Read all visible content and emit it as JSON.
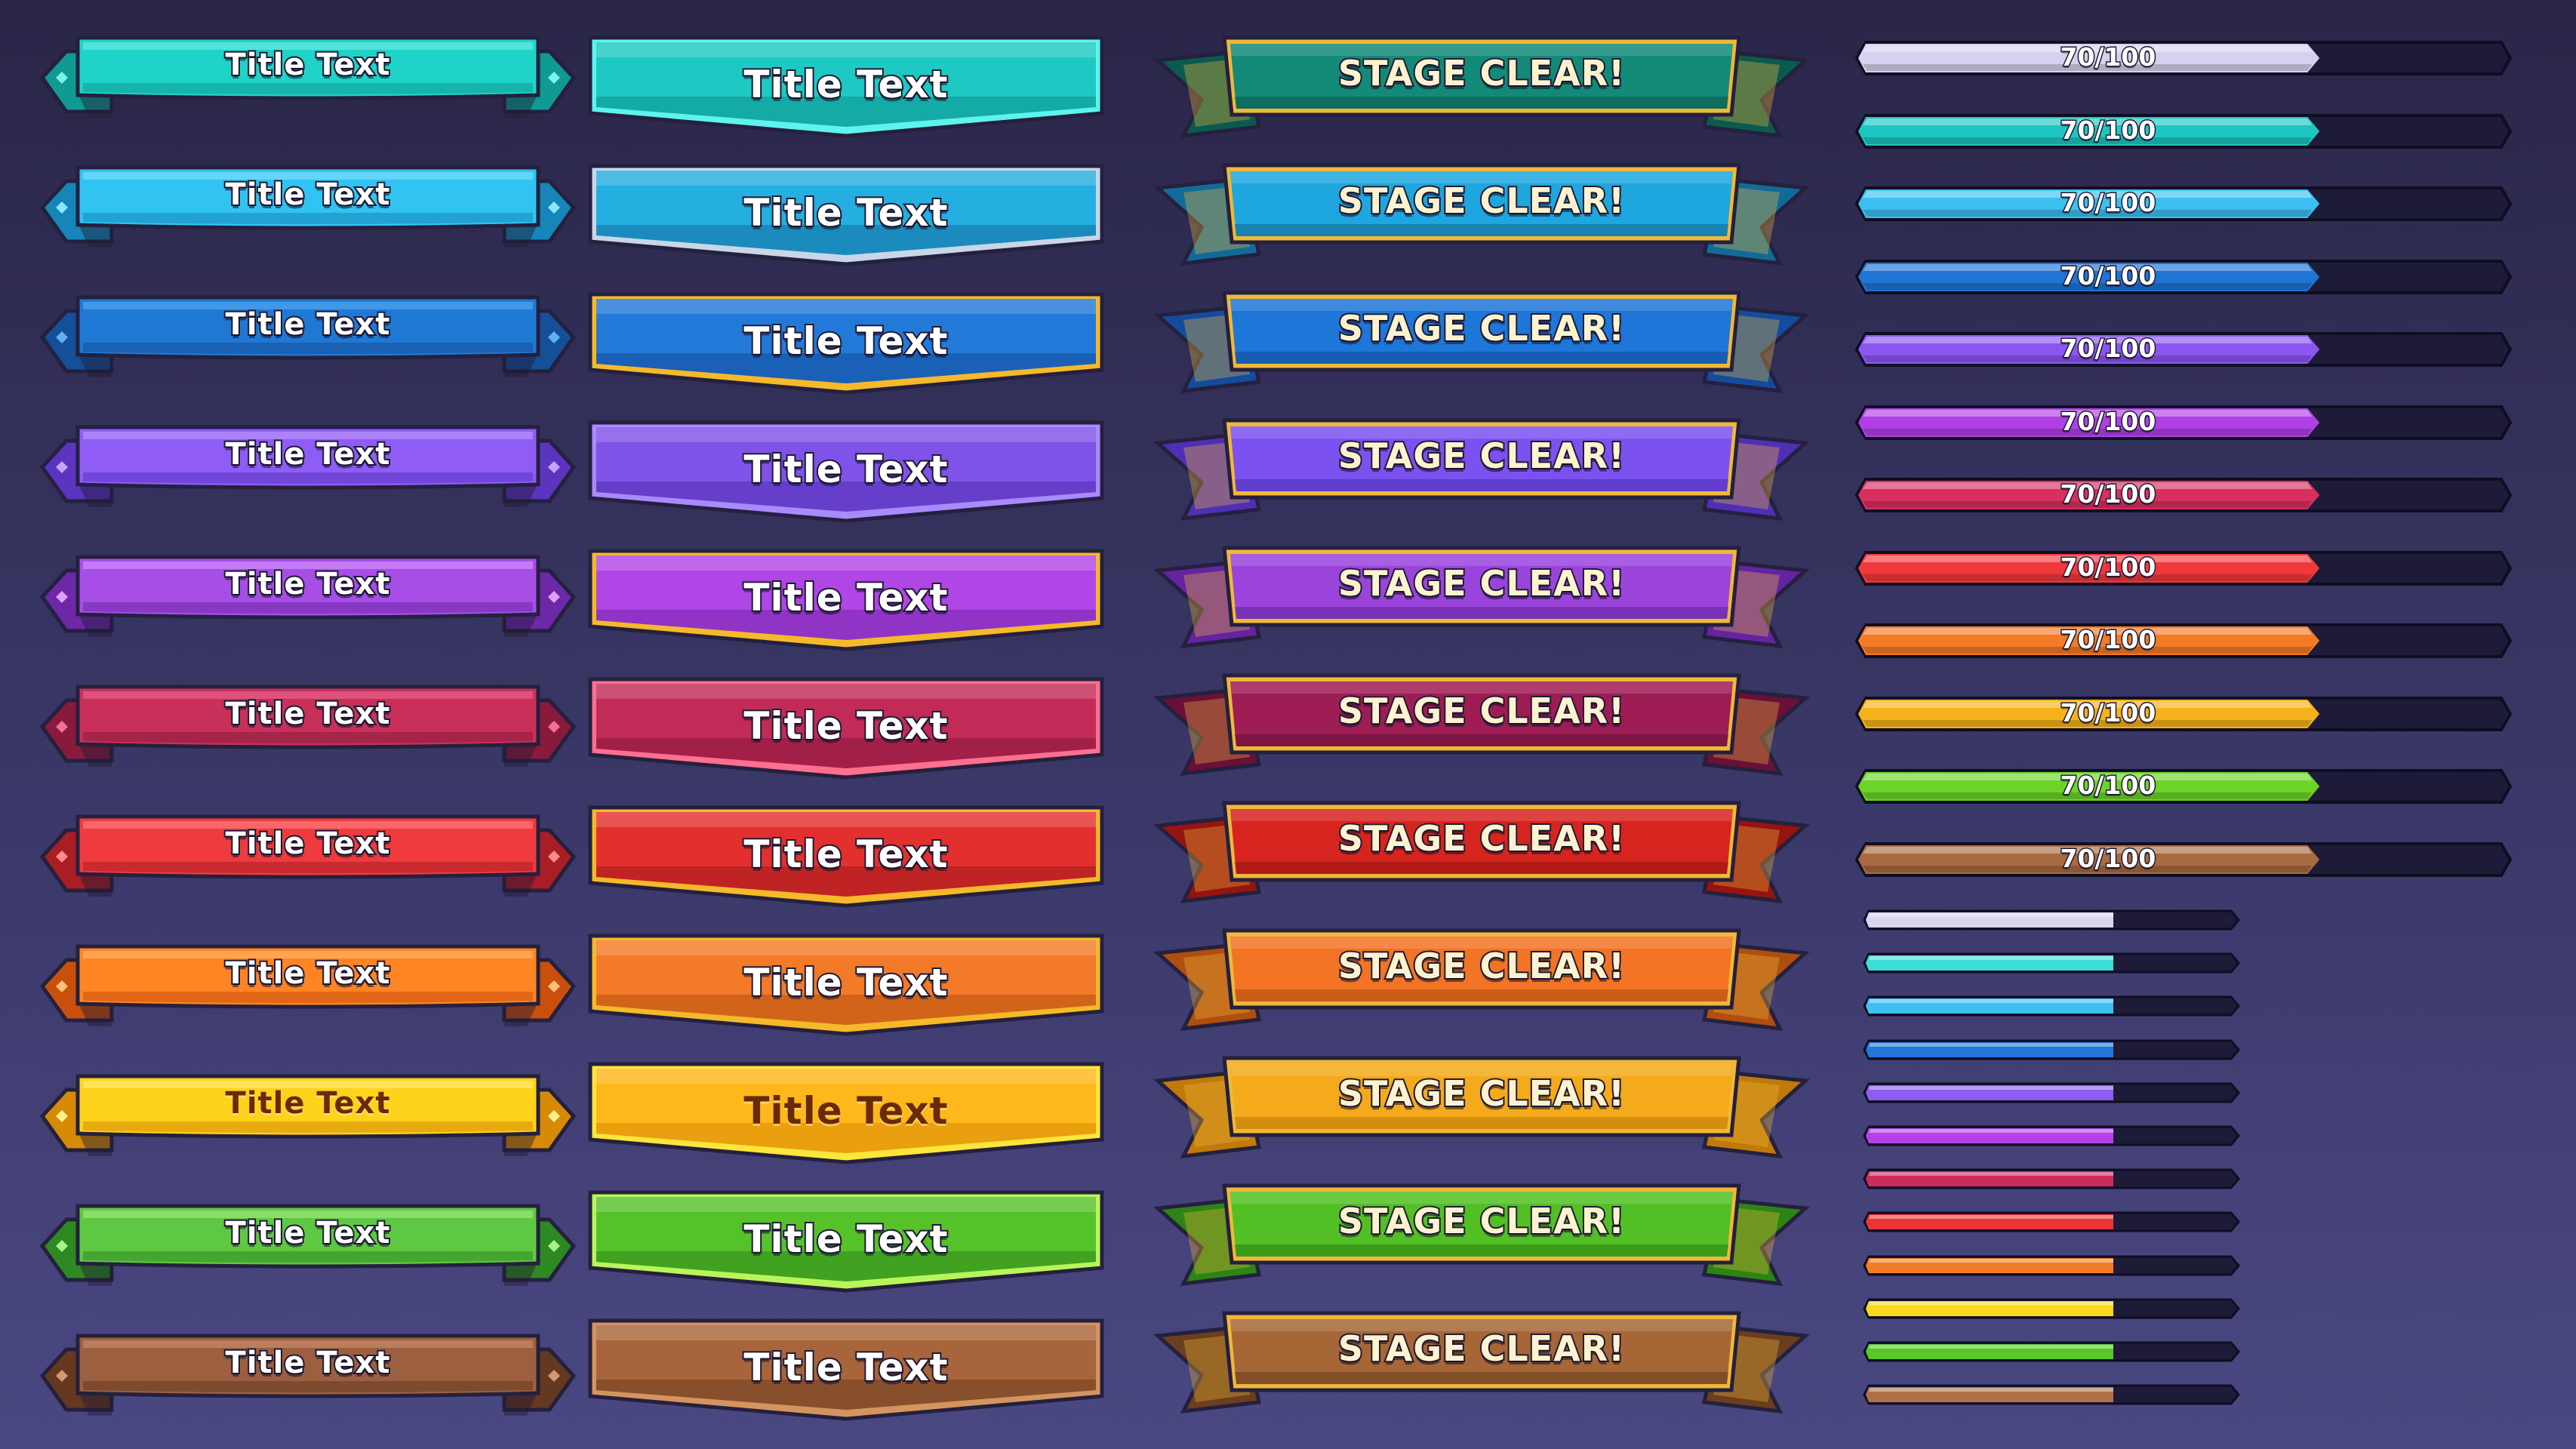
{
  "column_a": {
    "label": "Title Text",
    "colors": [
      {
        "main": "#1fd3c8",
        "dark": "#0f9a93",
        "light": "#7af3ea",
        "textDark": false
      },
      {
        "main": "#31c4f2",
        "dark": "#1686b8",
        "light": "#8ce6ff",
        "textDark": false
      },
      {
        "main": "#1f79d4",
        "dark": "#144f98",
        "light": "#5fb0f5",
        "textDark": false
      },
      {
        "main": "#8f5cf5",
        "dark": "#5b34c0",
        "light": "#c4a4ff",
        "textDark": false
      },
      {
        "main": "#a64ee6",
        "dark": "#6d28a8",
        "light": "#dca0ff",
        "textDark": false
      },
      {
        "main": "#c8305a",
        "dark": "#8a1a3c",
        "light": "#f0709a",
        "textDark": false
      },
      {
        "main": "#ef3a3e",
        "dark": "#a81e24",
        "light": "#ff8a8a",
        "textDark": false
      },
      {
        "main": "#ff8424",
        "dark": "#c9500c",
        "light": "#ffc07a",
        "textDark": false
      },
      {
        "main": "#ffd21c",
        "dark": "#d68a06",
        "light": "#fff08a",
        "textDark": true
      },
      {
        "main": "#5fc842",
        "dark": "#2d8a22",
        "light": "#aaf08a",
        "textDark": false
      },
      {
        "main": "#9c6040",
        "dark": "#653820",
        "light": "#d39874",
        "textDark": false
      }
    ]
  },
  "column_b": {
    "label": "Title Text",
    "colors": [
      {
        "main": "#1ec9c4",
        "dark": "#0d8f8c",
        "border": "#5ff3ee",
        "textDark": false
      },
      {
        "main": "#25aee0",
        "dark": "#146fa0",
        "border": "#c9d6e8",
        "textDark": false
      },
      {
        "main": "#2279d8",
        "dark": "#154d9c",
        "border": "#f5b92a",
        "textDark": false
      },
      {
        "main": "#7f52e8",
        "dark": "#5130b0",
        "border": "#a98bff",
        "textDark": false
      },
      {
        "main": "#b046e6",
        "dark": "#7626aa",
        "border": "#f5b92a",
        "textDark": false
      },
      {
        "main": "#c22a58",
        "dark": "#88163c",
        "border": "#ff6f8f",
        "textDark": false
      },
      {
        "main": "#e3302e",
        "dark": "#a21a1c",
        "border": "#f5b92a",
        "textDark": false
      },
      {
        "main": "#f27a28",
        "dark": "#b8520e",
        "border": "#f5b92a",
        "textDark": false
      },
      {
        "main": "#ffb81c",
        "dark": "#d88a06",
        "border": "#ffe63a",
        "textDark": true
      },
      {
        "main": "#56c22a",
        "dark": "#2f8818",
        "border": "#b9f55a",
        "textDark": false
      },
      {
        "main": "#a8643a",
        "dark": "#6e3e20",
        "border": "#d49460",
        "textDark": false
      }
    ]
  },
  "column_c": {
    "label": "STAGE CLEAR!",
    "trim": "#f0b838",
    "colors": [
      {
        "main": "#138a78",
        "dark": "#0b5a4e"
      },
      {
        "main": "#1ea6de",
        "dark": "#126a98"
      },
      {
        "main": "#1e76d8",
        "dark": "#134c9c"
      },
      {
        "main": "#7b52f0",
        "dark": "#4f30b4"
      },
      {
        "main": "#9a44dc",
        "dark": "#6424a0"
      },
      {
        "main": "#9e1c54",
        "dark": "#6a1038"
      },
      {
        "main": "#d8241e",
        "dark": "#961410"
      },
      {
        "main": "#f27424",
        "dark": "#b04e10"
      },
      {
        "main": "#f4aa1a",
        "dark": "#c07a0a"
      },
      {
        "main": "#52c024",
        "dark": "#2c8414"
      },
      {
        "main": "#a66636",
        "dark": "#6a3e1e"
      }
    ]
  },
  "bars_large": {
    "text": "70/100",
    "value": 70,
    "max": 100,
    "colors": [
      "#d4d2ee",
      "#1ec6c2",
      "#3cc0f0",
      "#1f74d4",
      "#8b56f0",
      "#b040e6",
      "#d8305e",
      "#f2383c",
      "#f47a26",
      "#f5b21a",
      "#6cd428",
      "#a86a40"
    ]
  },
  "bars_small": {
    "value": 0.7,
    "colors": [
      "#d8d6f0",
      "#3edcd8",
      "#3ec0f0",
      "#2278d8",
      "#8f5cf0",
      "#b640ea",
      "#cc2c5c",
      "#ee3434",
      "#f47c24",
      "#f6d81e",
      "#58c828",
      "#b07048"
    ]
  }
}
